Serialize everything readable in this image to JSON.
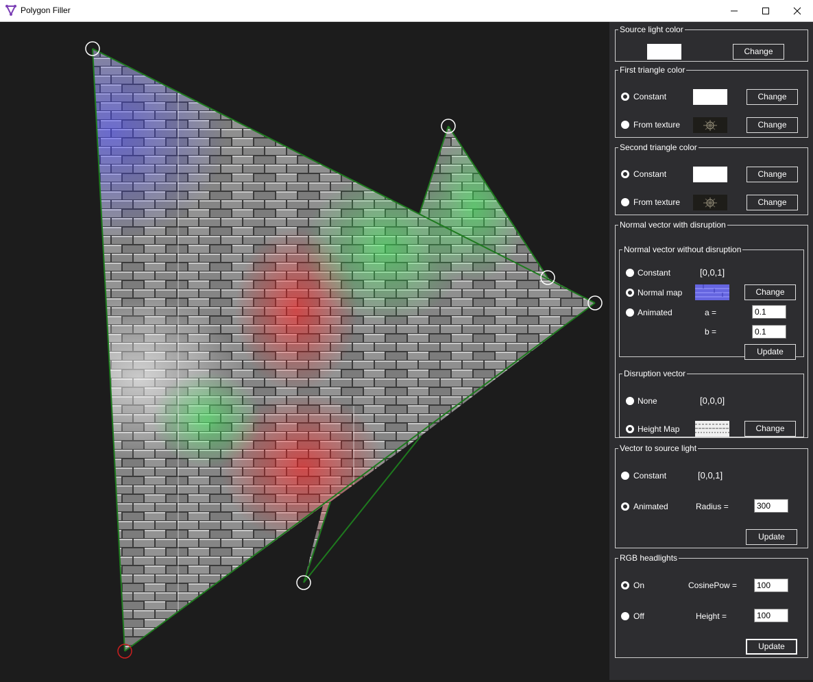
{
  "window": {
    "title": "Polygon Filler",
    "controls": [
      "minimize-icon",
      "maximize-icon",
      "close-icon"
    ]
  },
  "canvas": {
    "background": "#1c1c1c",
    "edge_color": "#1e7a1e",
    "vertex_color": "#ffffff",
    "selected_vertex_color": "#cc1f1f",
    "fill": "brick-texture-with-rgb-headlights"
  },
  "panel": {
    "source_light_color": {
      "title": "Source light color",
      "swatch_color": "#ffffff",
      "change_label": "Change"
    },
    "first_triangle_color": {
      "title": "First triangle color",
      "constant_label": "Constant",
      "from_texture_label": "From texture",
      "selected": "Constant",
      "swatch_color": "#ffffff",
      "change_label": "Change"
    },
    "second_triangle_color": {
      "title": "Second triangle color",
      "constant_label": "Constant",
      "from_texture_label": "From texture",
      "selected": "Constant",
      "swatch_color": "#ffffff",
      "change_label": "Change"
    },
    "normal_vector_with_disruption": {
      "title": "Normal vector with disruption",
      "without_disruption": {
        "title": "Normal vector without disruption",
        "constant_label": "Constant",
        "constant_value": "[0,0,1]",
        "normal_map_label": "Normal map",
        "animated_label": "Animated",
        "selected": "Normal map",
        "change_label": "Change",
        "a_label": "a =",
        "a_value": "0.1",
        "b_label": "b =",
        "b_value": "0.1",
        "update_label": "Update"
      },
      "disruption_vector": {
        "title": "Disruption vector",
        "none_label": "None",
        "none_value": "[0,0,0]",
        "height_map_label": "Height Map",
        "selected": "Height Map",
        "change_label": "Change"
      }
    },
    "vector_to_source_light": {
      "title": "Vector to source light",
      "constant_label": "Constant",
      "constant_value": "[0,0,1]",
      "animated_label": "Animated",
      "selected": "Animated",
      "radius_label": "Radius =",
      "radius_value": "300",
      "update_label": "Update"
    },
    "rgb_headlights": {
      "title": "RGB headlights",
      "on_label": "On",
      "off_label": "Off",
      "selected": "On",
      "cosinepow_label": "CosinePow =",
      "cosinepow_value": "100",
      "height_label": "Height =",
      "height_value": "100",
      "update_label": "Update"
    }
  }
}
